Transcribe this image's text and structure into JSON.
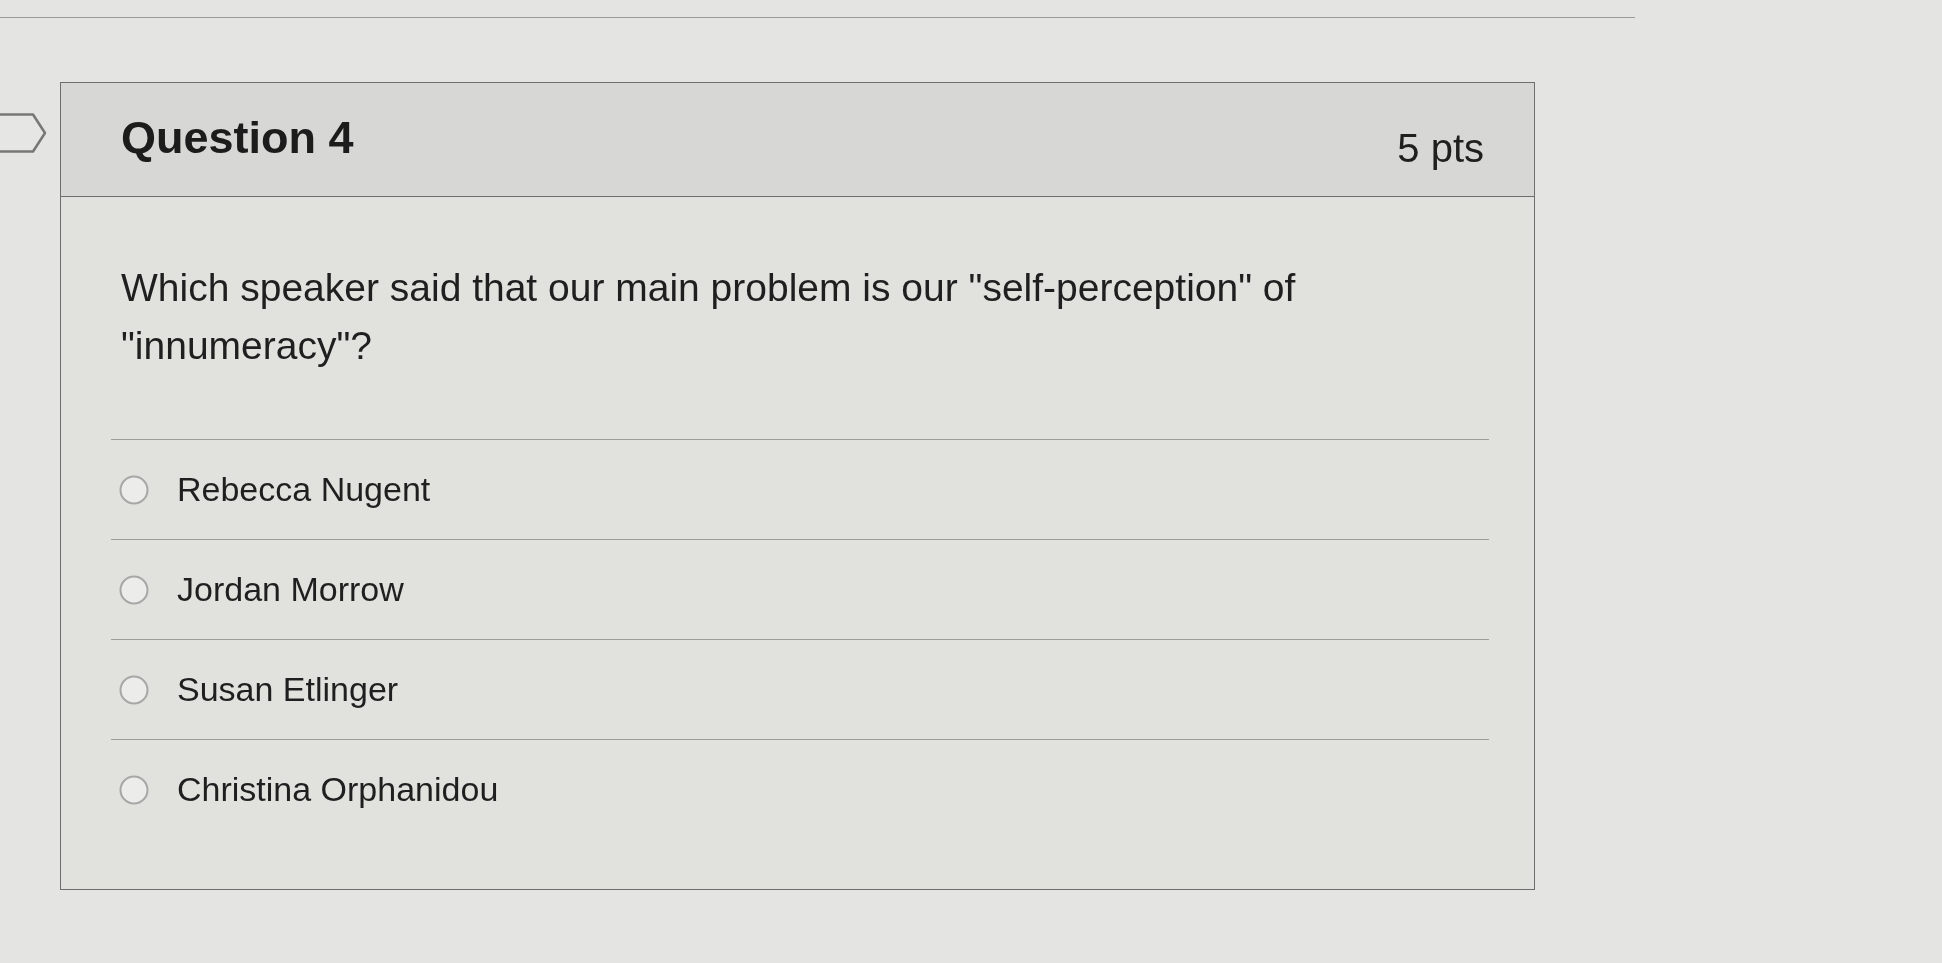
{
  "question": {
    "title": "Question 4",
    "points": "5 pts",
    "text": "Which speaker said that our main problem is our \"self-perception\" of \"innumeracy\"?",
    "answers": [
      {
        "label": "Rebecca Nugent",
        "selected": false
      },
      {
        "label": "Jordan Morrow",
        "selected": false
      },
      {
        "label": "Susan Etlinger",
        "selected": false
      },
      {
        "label": "Christina Orphanidou",
        "selected": false
      }
    ]
  }
}
